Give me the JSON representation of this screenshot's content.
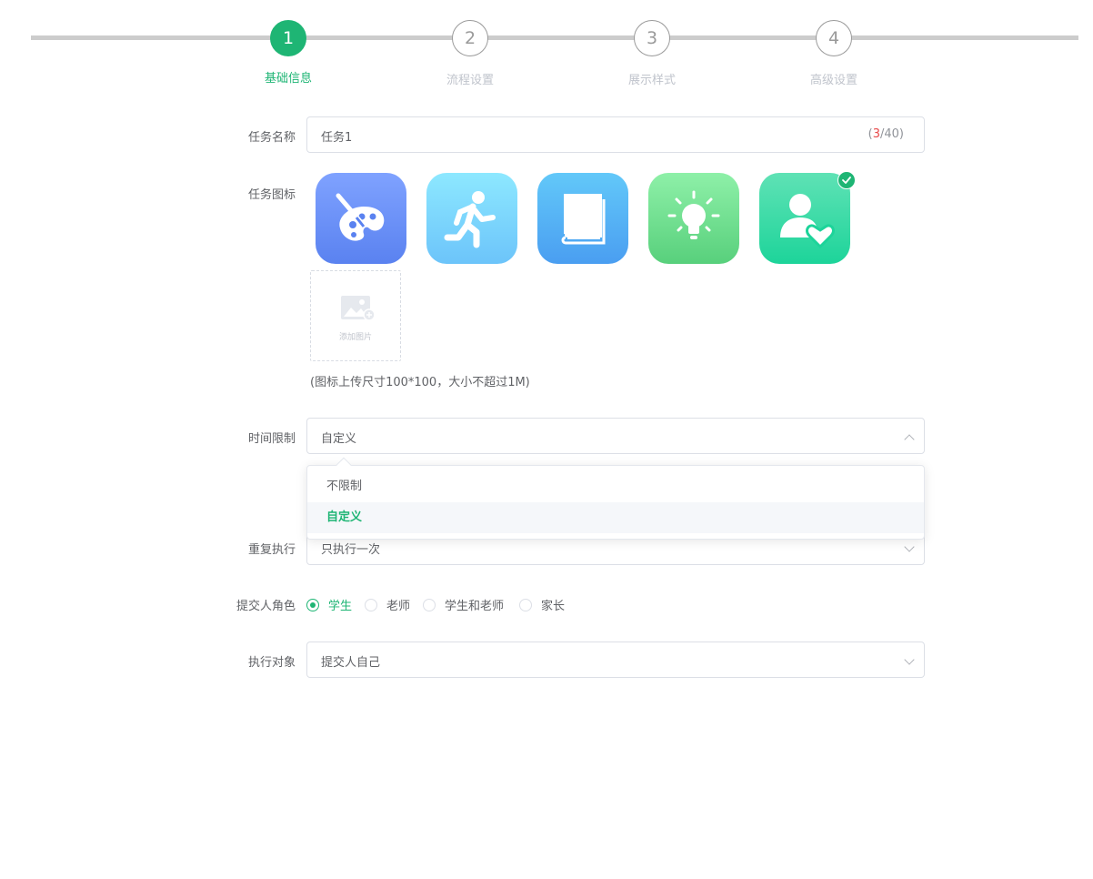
{
  "steps": [
    {
      "num": "1",
      "label": "基础信息",
      "active": true
    },
    {
      "num": "2",
      "label": "流程设置",
      "active": false
    },
    {
      "num": "3",
      "label": "展示样式",
      "active": false
    },
    {
      "num": "4",
      "label": "高级设置",
      "active": false
    }
  ],
  "form": {
    "task_name": {
      "label": "任务名称",
      "value": "任务1",
      "counter_open": "(",
      "counter_current": "3",
      "counter_max": "/40)"
    },
    "task_icon": {
      "label": "任务图标",
      "icons": [
        "palette-icon",
        "running-person-icon",
        "book-icon",
        "lightbulb-icon",
        "user-heart-icon"
      ],
      "selected_index": 4,
      "upload_label": "添加图片",
      "hint": "(图标上传尺寸100*100，大小不超过1M)"
    },
    "time_limit": {
      "label": "时间限制",
      "value": "自定义",
      "options": [
        "不限制",
        "自定义"
      ],
      "selected": "自定义"
    },
    "repeat": {
      "label": "重复执行",
      "value": "只执行一次"
    },
    "submitter_role": {
      "label": "提交人角色",
      "options": [
        "学生",
        "老师",
        "学生和老师",
        "家长"
      ],
      "selected": "学生"
    },
    "exec_target": {
      "label": "执行对象",
      "value": "提交人自己"
    }
  },
  "colors": {
    "accent": "#1eb574",
    "counter_highlight": "#e84a4a",
    "icon_gradients": [
      [
        "#7fa2ff",
        "#5a82f0"
      ],
      [
        "#8de8ff",
        "#6cc4fa"
      ],
      [
        "#62c8f9",
        "#4a9ef1"
      ],
      [
        "#8ef0a8",
        "#58d07c"
      ],
      [
        "#5fe2b5",
        "#1dd49a"
      ]
    ]
  }
}
